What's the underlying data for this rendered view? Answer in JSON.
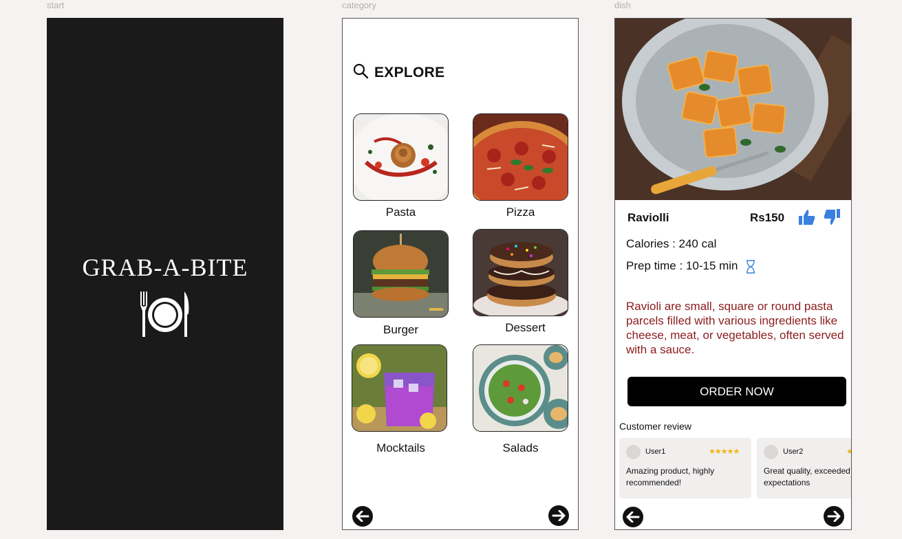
{
  "frames": {
    "start": {
      "label": "start",
      "app_title": "GRAB-A-BITE",
      "icon": "fork-plate-knife-icon"
    },
    "category": {
      "label": "category",
      "heading": "EXPLORE",
      "search_icon": "search-icon",
      "items": [
        {
          "label": "Pasta",
          "image": "pasta-photo"
        },
        {
          "label": "Pizza",
          "image": "pizza-photo"
        },
        {
          "label": "Burger",
          "image": "burger-photo"
        },
        {
          "label": "Dessert",
          "image": "donuts-photo"
        },
        {
          "label": "Mocktails",
          "image": "mocktail-photo"
        },
        {
          "label": "Salads",
          "image": "salad-photo"
        }
      ],
      "nav": {
        "back_icon": "arrow-left-icon",
        "next_icon": "arrow-right-icon"
      }
    },
    "dish": {
      "label": "dish",
      "name": "Raviolli",
      "price": "Rs150",
      "calories": "Calories : 240 cal",
      "prep_time": "Prep time : 10-15 min",
      "description": "Ravioli are small, square or round pasta parcels filled with various ingredients like cheese, meat, or vegetables, often served with a sauce.",
      "order_button": "ORDER NOW",
      "reviews_title": "Customer review",
      "reviews": [
        {
          "user": "User1",
          "stars": "★★★★★",
          "text": "Amazing product, highly recommended!"
        },
        {
          "user": "User2",
          "stars": "★",
          "text": "Great quality, exceeded expectations"
        }
      ],
      "colors": {
        "accent_blue": "#3b7fe0",
        "description_red": "#8b1c1c",
        "star": "#f5b50a"
      }
    }
  }
}
